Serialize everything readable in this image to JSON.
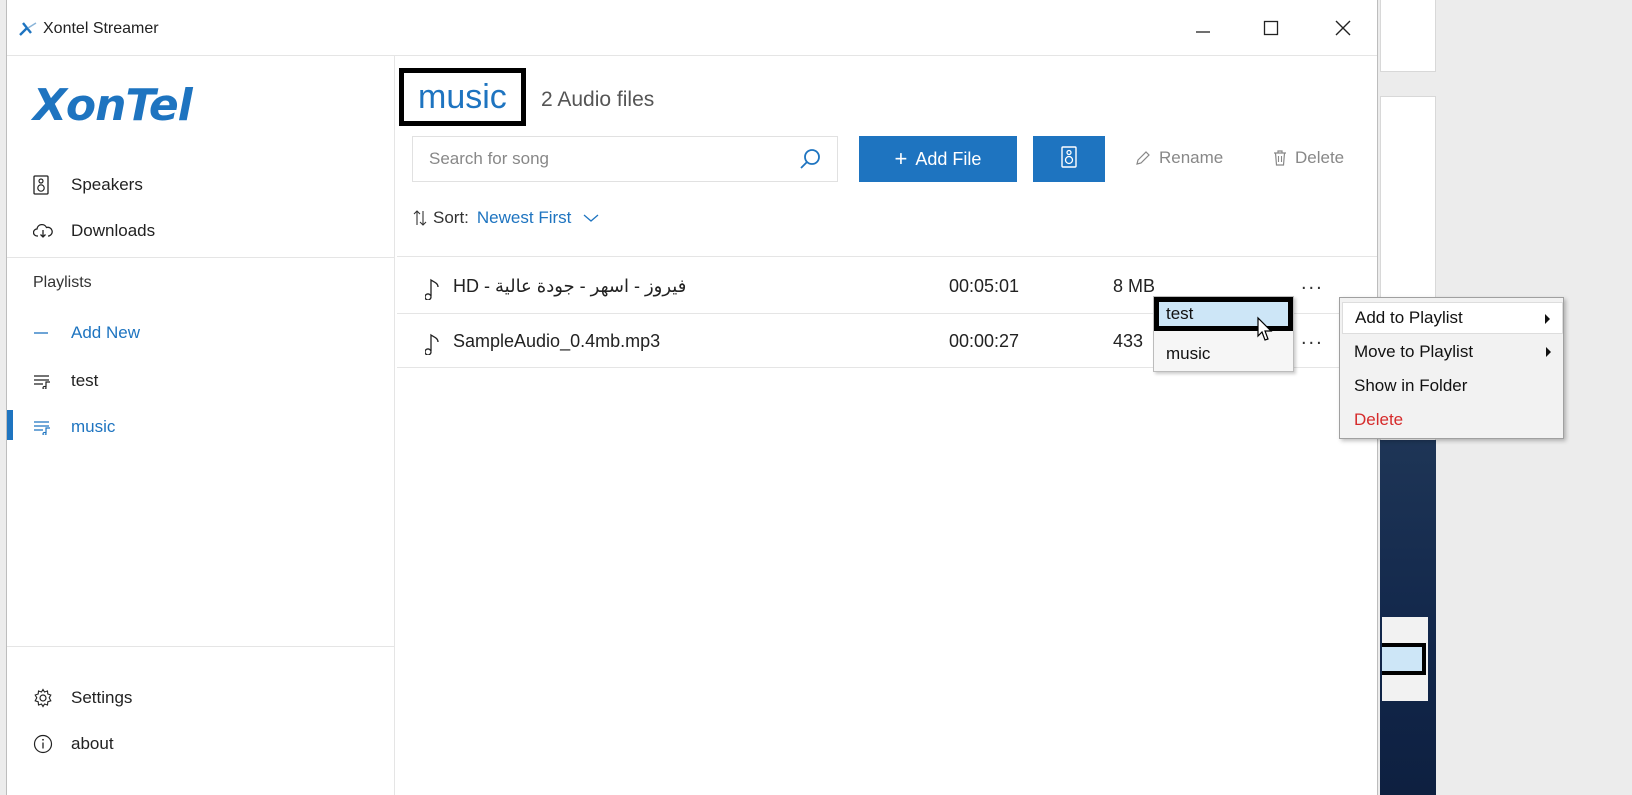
{
  "window": {
    "title": "Xontel Streamer",
    "icons": {
      "app": "xontel-logo-icon",
      "minimize": "minimize-icon",
      "maximize": "maximize-icon",
      "close": "close-icon"
    }
  },
  "sidebar": {
    "logo": "XonTel",
    "nav": [
      {
        "label": "Speakers",
        "icon": "speaker-icon"
      },
      {
        "label": "Downloads",
        "icon": "cloud-download-icon"
      }
    ],
    "playlists_header": "Playlists",
    "add_new": "Add New",
    "playlists": [
      {
        "label": "test",
        "icon": "playlist-icon",
        "active": false
      },
      {
        "label": "music",
        "icon": "playlist-icon",
        "active": true
      }
    ],
    "footer": [
      {
        "label": "Settings",
        "icon": "gear-icon"
      },
      {
        "label": "about",
        "icon": "info-icon"
      }
    ]
  },
  "main": {
    "title": "music",
    "subtitle": "2 Audio files",
    "search_placeholder": "Search for song",
    "add_file_label": "Add File",
    "rename_label": "Rename",
    "delete_label": "Delete",
    "sort_label": "Sort:",
    "sort_value": "Newest First",
    "accent_color": "#1e74c0",
    "files": [
      {
        "name": "فيروز - اسهر - جودة عالية - HD",
        "duration": "00:05:01",
        "size": "8 MB"
      },
      {
        "name": "SampleAudio_0.4mb.mp3",
        "duration": "00:00:27",
        "size": "433"
      }
    ],
    "row_menu": "..."
  },
  "submenu": {
    "items": [
      "test",
      "music"
    ],
    "highlighted": "test"
  },
  "context_menu": {
    "items": [
      {
        "label": "Add to Playlist",
        "has_submenu": true
      },
      {
        "label": "Move to Playlist",
        "has_submenu": true
      },
      {
        "label": "Show in Folder",
        "has_submenu": false
      },
      {
        "label": "Delete",
        "has_submenu": false,
        "danger_color": "#d62b2b"
      }
    ]
  }
}
